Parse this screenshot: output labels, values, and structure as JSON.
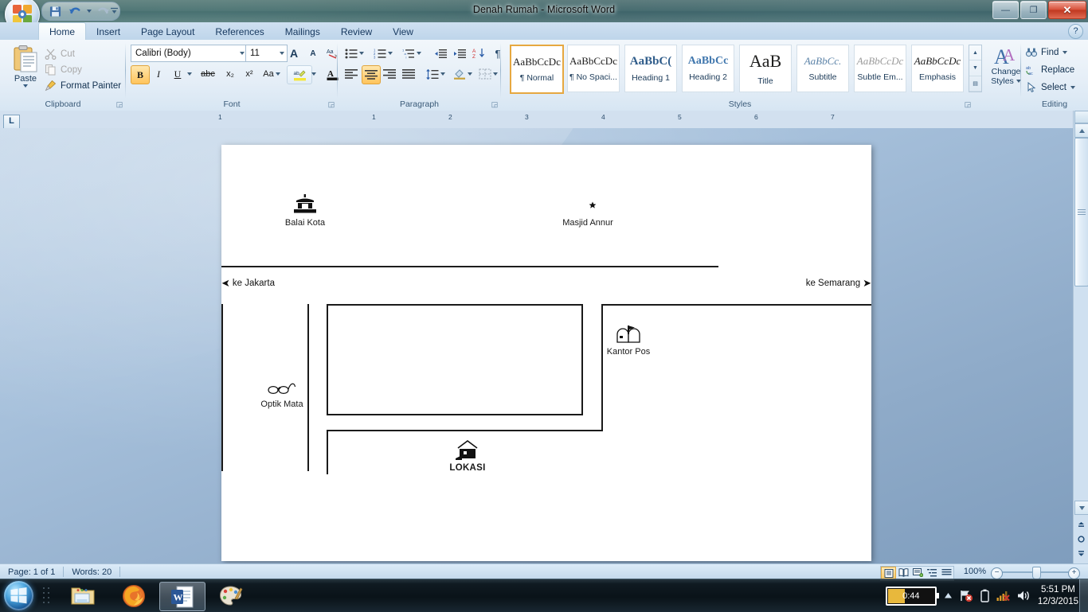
{
  "window": {
    "title": "Denah Rumah - Microsoft Word",
    "minimize_label": "—",
    "restore_label": "❐",
    "close_label": "✕",
    "help_label": "?"
  },
  "quick_access": {
    "items": [
      {
        "name": "save-icon",
        "label": "Save"
      },
      {
        "name": "undo-icon",
        "label": "Undo"
      },
      {
        "name": "redo-icon",
        "label": "Redo"
      }
    ],
    "customize_label": "Customize Quick Access Toolbar"
  },
  "ribbon": {
    "tabs": [
      {
        "label": "Home",
        "active": true
      },
      {
        "label": "Insert",
        "active": false
      },
      {
        "label": "Page Layout",
        "active": false
      },
      {
        "label": "References",
        "active": false
      },
      {
        "label": "Mailings",
        "active": false
      },
      {
        "label": "Review",
        "active": false
      },
      {
        "label": "View",
        "active": false
      }
    ],
    "clipboard": {
      "group_label": "Clipboard",
      "paste_label": "Paste",
      "cut_label": "Cut",
      "copy_label": "Copy",
      "format_painter_label": "Format Painter"
    },
    "font": {
      "group_label": "Font",
      "font_name": "Calibri (Body)",
      "font_size": "11",
      "grow_label": "A",
      "shrink_label": "A",
      "clear_format_label": "Aa",
      "bold_label": "B",
      "italic_label": "I",
      "underline_label": "U",
      "strike_label": "abc",
      "subscript_label": "x₂",
      "superscript_label": "x²",
      "change_case_label": "Aa",
      "highlight_label": "ab",
      "font_color_label": "A"
    },
    "paragraph": {
      "group_label": "Paragraph"
    },
    "styles": {
      "group_label": "Styles",
      "items": [
        {
          "preview": "AaBbCcDc",
          "name": "¶ Normal",
          "selected": true
        },
        {
          "preview": "AaBbCcDc",
          "name": "¶ No Spaci...",
          "selected": false
        },
        {
          "preview": "AaBbC(",
          "name": "Heading 1",
          "selected": false
        },
        {
          "preview": "AaBbCc",
          "name": "Heading 2",
          "selected": false
        },
        {
          "preview": "AaB",
          "name": "Title",
          "selected": false
        },
        {
          "preview": "AaBbCc.",
          "name": "Subtitle",
          "selected": false
        },
        {
          "preview": "AaBbCcDc",
          "name": "Subtle Em...",
          "selected": false
        },
        {
          "preview": "AaBbCcDc",
          "name": "Emphasis",
          "selected": false
        }
      ],
      "change_styles_line1": "Change",
      "change_styles_line2": "Styles"
    },
    "editing": {
      "group_label": "Editing",
      "find_label": "Find",
      "replace_label": "Replace",
      "select_label": "Select"
    }
  },
  "ruler": {
    "tab_selector_label": "L",
    "marks": [
      "1",
      "1",
      "2",
      "3",
      "4",
      "5",
      "6",
      "7"
    ]
  },
  "document": {
    "map_title": "Denah Rumah",
    "landmarks": [
      {
        "id": "balai-kota",
        "label": "Balai Kota",
        "icon": "building-icon"
      },
      {
        "id": "masjid-annur",
        "label": "Masjid Annur",
        "icon": "crescent-moon-icon"
      },
      {
        "id": "optik-mata",
        "label": "Optik Mata",
        "icon": "eyeglasses-icon"
      },
      {
        "id": "kantor-pos",
        "label": "Kantor Pos",
        "icon": "mailbox-icon"
      },
      {
        "id": "lokasi",
        "label": "LOKASI",
        "icon": "house-icon"
      }
    ],
    "directions": [
      {
        "id": "ke-jakarta",
        "label": "ke Jakarta",
        "arrow": "left-arrow-icon"
      },
      {
        "id": "ke-semarang",
        "label": "ke Semarang",
        "arrow": "right-arrow-icon"
      }
    ]
  },
  "status_bar": {
    "page_label": "Page: 1 of 1",
    "words_label": "Words: 20",
    "zoom_label": "100%",
    "zoom_out_label": "−",
    "zoom_in_label": "+",
    "views": [
      {
        "name": "print-layout-view",
        "active": true
      },
      {
        "name": "full-screen-reading-view",
        "active": false
      },
      {
        "name": "web-layout-view",
        "active": false
      },
      {
        "name": "outline-view",
        "active": false
      },
      {
        "name": "draft-view",
        "active": false
      }
    ]
  },
  "taskbar": {
    "start_label": "Start",
    "apps": [
      {
        "name": "windows-explorer",
        "label": "Windows Explorer",
        "running": false
      },
      {
        "name": "firefox",
        "label": "Mozilla Firefox",
        "running": false
      },
      {
        "name": "microsoft-word",
        "label": "Microsoft Word",
        "running": true
      },
      {
        "name": "paint",
        "label": "Paint",
        "running": false
      }
    ],
    "battery_label": "0:44",
    "time": "5:51 PM",
    "date": "12/3/2015",
    "show_desktop_label": "Show desktop"
  }
}
